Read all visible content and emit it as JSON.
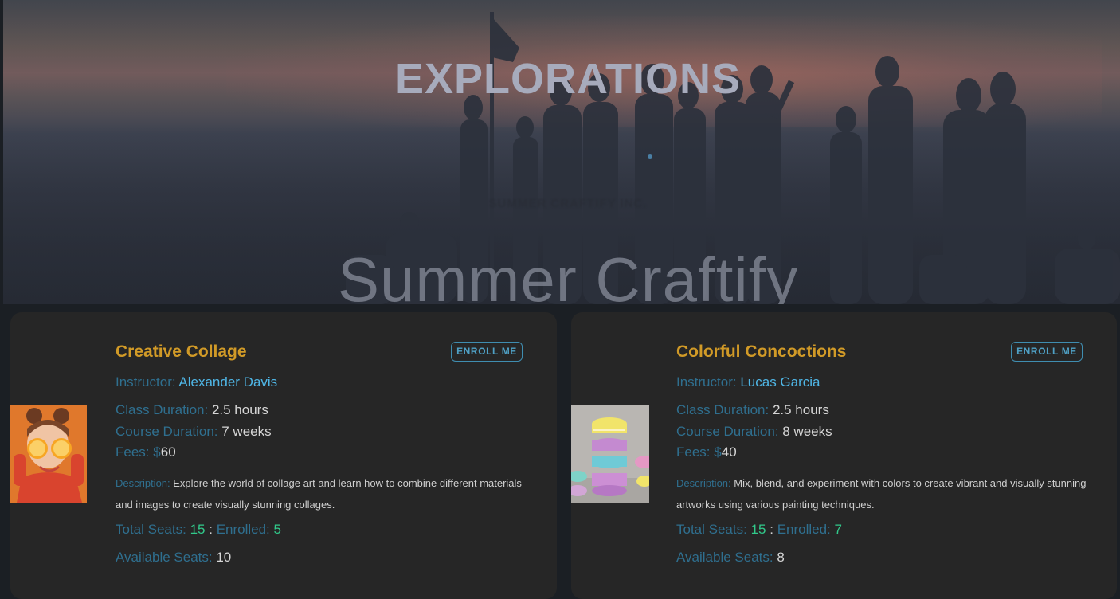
{
  "hero": {
    "title": "EXPLORATIONS",
    "caption": "SUMMER CRAFTIFY INC.",
    "script_text": "Summer Craftify"
  },
  "labels": {
    "instructor": "Instructor:",
    "class_duration": "Class Duration:",
    "course_duration": "Course Duration:",
    "fees": "Fees:",
    "currency": "$",
    "description": "Description:",
    "total_seats": "Total Seats:",
    "separator": ":",
    "enrolled": "Enrolled:",
    "available_seats": "Available Seats:"
  },
  "classes": [
    {
      "title": "Creative Collage",
      "enroll_label": "ENROLL ME",
      "instructor": "Alexander Davis",
      "class_duration": "2.5 hours",
      "course_duration": "7 weeks",
      "fees": "60",
      "description": "Explore the world of collage art and learn how to combine different materials and images to create visually stunning collages.",
      "total_seats": "15",
      "enrolled": "5",
      "available_seats": "10",
      "image_icon": "girl-with-orange-slices-photo"
    },
    {
      "title": "Colorful Concoctions",
      "enroll_label": "ENROLL ME",
      "instructor": "Lucas Garcia",
      "class_duration": "2.5 hours",
      "course_duration": "8 weeks",
      "fees": "40",
      "description": "Mix, blend, and experiment with colors to create vibrant and visually stunning artworks using various painting techniques.",
      "total_seats": "15",
      "enrolled": "7",
      "available_seats": "8",
      "image_icon": "macaron-stack-photo"
    }
  ],
  "colors": {
    "title": "#d19a27",
    "label": "#2f6f8f",
    "accent_blue": "#4fb6e6",
    "accent_green": "#31c98a",
    "card_bg": "#262626",
    "page_bg": "#1b1f24"
  }
}
